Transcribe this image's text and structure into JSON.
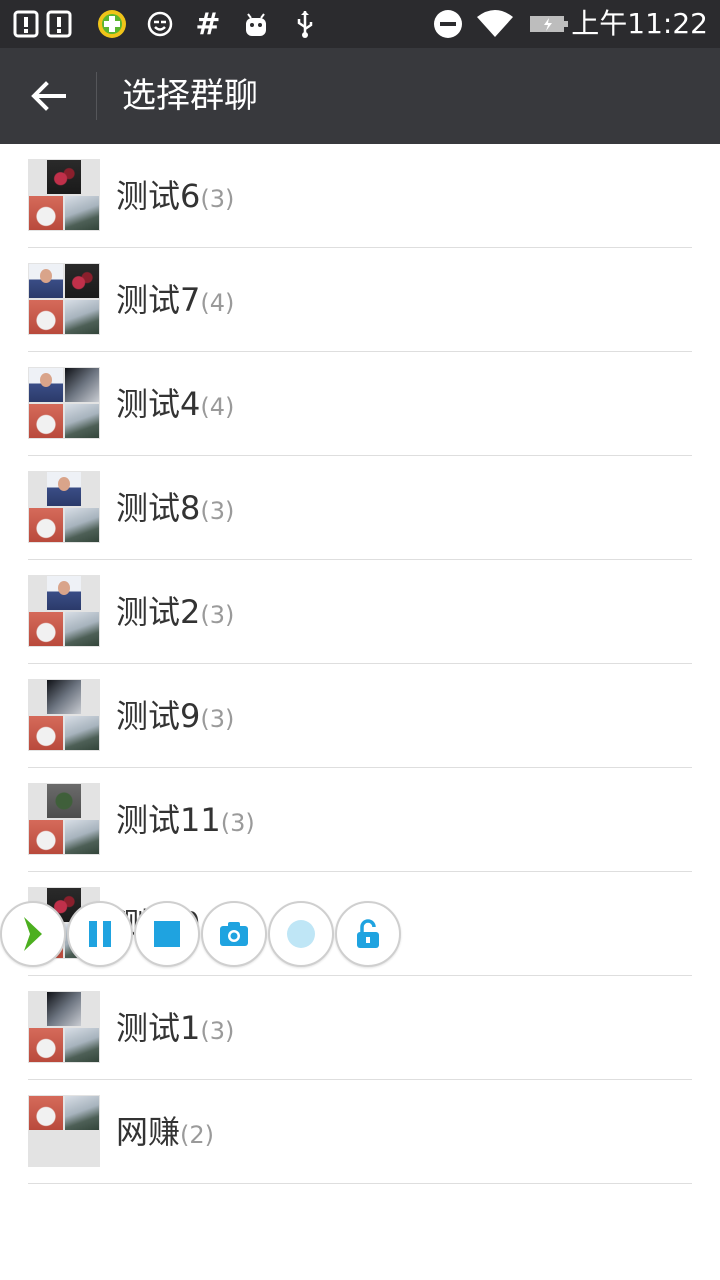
{
  "status_bar": {
    "time": "上午11:22",
    "icons": [
      "alert-box-icon",
      "alert-box-icon",
      "360-security-icon",
      "smile-icon",
      "hash-icon",
      "android-icon",
      "usb-icon",
      "do-not-disturb-icon",
      "wifi-icon",
      "battery-charging-icon"
    ]
  },
  "app_bar": {
    "back_icon": "arrow-left-icon",
    "title": "选择群聊"
  },
  "groups": [
    {
      "name": "测试6",
      "count": "(3)"
    },
    {
      "name": "测试7",
      "count": "(4)"
    },
    {
      "name": "测试4",
      "count": "(4)"
    },
    {
      "name": "测试8",
      "count": "(3)"
    },
    {
      "name": "测试2",
      "count": "(3)"
    },
    {
      "name": "测试9",
      "count": "(3)"
    },
    {
      "name": "测试11",
      "count": "(3)"
    },
    {
      "name": "测试0",
      "count": ""
    },
    {
      "name": "测试1",
      "count": "(3)"
    },
    {
      "name": "网赚",
      "count": "(2)"
    }
  ],
  "floating_toolbar": {
    "buttons": [
      "expand-chevron-icon",
      "pause-icon",
      "stop-icon",
      "camera-icon",
      "record-dot-icon",
      "unlock-icon"
    ]
  },
  "colors": {
    "status_bar_bg": "#2b2b2e",
    "app_bar_bg": "#38393d",
    "accent_blue": "#1fa3e0",
    "accent_green": "#4caf1f",
    "divider": "#dedede",
    "count_gray": "#9a9a9a"
  }
}
